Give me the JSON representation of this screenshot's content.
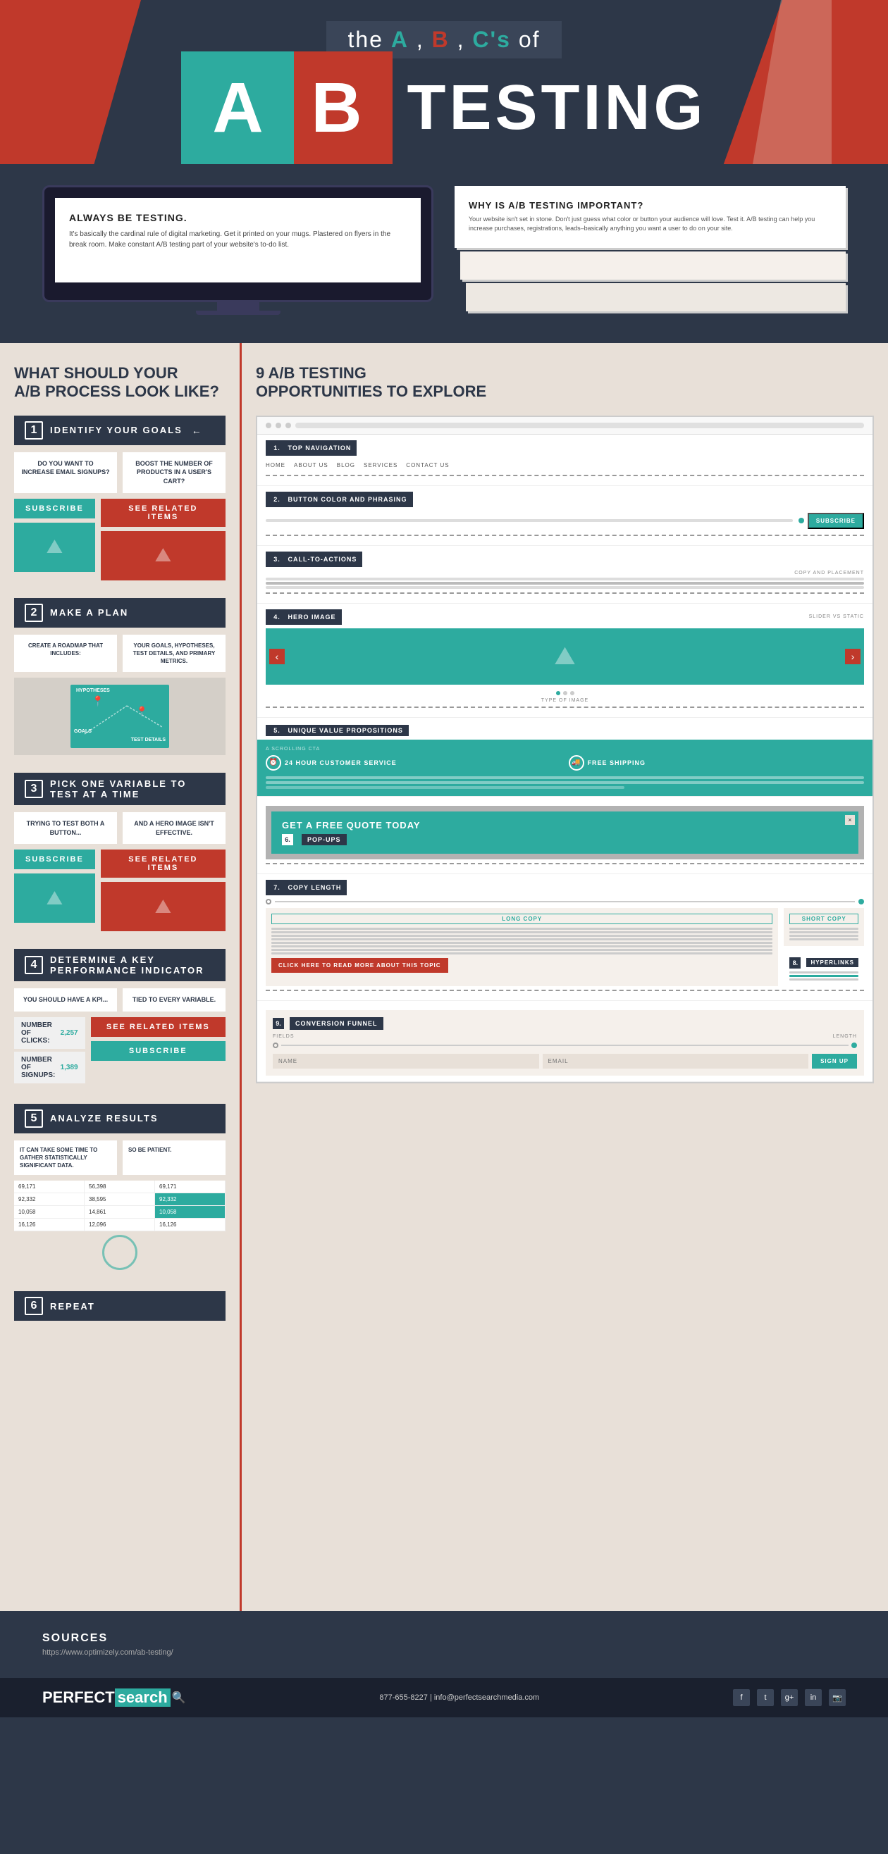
{
  "header": {
    "title_line": "the A, B, C's of",
    "letters": {
      "a": "A",
      "b": "B",
      "cs": "C's"
    },
    "testing_word": "TESTING",
    "big_a": "A",
    "big_b": "B"
  },
  "laptop_card": {
    "title": "ALWAYS BE TESTING.",
    "body": "It's basically the cardinal rule of digital marketing. Get it printed on your mugs. Plastered on flyers in the break room. Make constant A/B testing part of your website's to-do list."
  },
  "paper_card": {
    "title": "WHY IS A/B TESTING IMPORTANT?",
    "body": "Your website isn't set in stone. Don't just guess what color or button your audience will love. Test it. A/B testing can help you increase purchases, registrations, leads–basically anything you want a user to do on your site."
  },
  "left_section": {
    "title_line1": "WHAT SHOULD YOUR",
    "title_line2": "A/B PROCESS LOOK LIKE?",
    "steps": [
      {
        "number": "1",
        "label": "IDENTIFY YOUR GOALS",
        "col1": "DO YOU WANT TO INCREASE EMAIL SIGNUPS?",
        "col2": "BOOST THE NUMBER OF PRODUCTS IN A USER'S CART?",
        "btn1": "SUBSCRIBE",
        "btn2": "SEE RELATED ITEMS"
      },
      {
        "number": "2",
        "label": "MAKE A PLAN",
        "col1": "CREATE A ROADMAP THAT INCLUDES:",
        "col2": "YOUR GOALS, HYPOTHESES, TEST DETAILS, AND PRIMARY METRICS."
      },
      {
        "number": "3",
        "label": "PICK ONE VARIABLE TO TEST AT A TIME",
        "col1": "TRYING TO TEST BOTH A BUTTON...",
        "col2": "AND A HERO IMAGE ISN'T EFFECTIVE.",
        "btn1": "SUBSCRIBE",
        "btn2": "SEE RELATED ITEMS"
      },
      {
        "number": "4",
        "label": "DETERMINE A KEY PERFORMANCE INDICATOR",
        "col1": "YOU SHOULD HAVE A KPI...",
        "col2": "TIED TO EVERY VARIABLE.",
        "kpi1_label": "NUMBER OF CLICKS:",
        "kpi1_value": "2,257",
        "kpi2_label": "NUMBER OF SIGNUPS:",
        "kpi2_value": "1,389",
        "btn_red": "SEE RELATED ITEMS",
        "btn_teal": "SUBSCRIBE"
      },
      {
        "number": "5",
        "label": "ANALYZE RESULTS",
        "col1": "IT CAN TAKE SOME TIME TO GATHER STATISTICALLY SIGNIFICANT DATA.",
        "col2": "SO BE PATIENT.",
        "table_rows": [
          [
            "69,171",
            "56,398",
            "69,171"
          ],
          [
            "92,332",
            "38,595",
            "92,332"
          ],
          [
            "10,058",
            "14,861",
            "10,058"
          ],
          [
            "16,126",
            "12,096",
            "16,126"
          ]
        ]
      },
      {
        "number": "6",
        "label": "REPEAT"
      }
    ]
  },
  "right_section": {
    "title_line1": "9 A/B TESTING",
    "title_line2": "OPPORTUNITIES TO EXPLORE",
    "items": [
      {
        "number": "1",
        "label": "TOP NAVIGATION"
      },
      {
        "number": "2",
        "label": "BUTTON COLOR AND PHRASING"
      },
      {
        "number": "3",
        "label": "CALL-TO-ACTIONS",
        "sublabel": "COPY AND PLACEMENT"
      },
      {
        "number": "4",
        "label": "HERO IMAGE",
        "sublabel": "SLIDER VS STATIC",
        "type_label": "TYPE OF IMAGE"
      },
      {
        "number": "5",
        "label": "UNIQUE VALUE PROPOSITIONS",
        "sublabel": "A SCROLLING CTA"
      },
      {
        "number": "6",
        "label": "POP-UPS",
        "popup_title": "GET A FREE QUOTE TODAY"
      },
      {
        "number": "7",
        "label": "COPY LENGTH",
        "sub1": "LONG COPY",
        "sub2": "SHORT COPY"
      },
      {
        "number": "8",
        "label": "HYPERLINKS"
      },
      {
        "number": "9",
        "label": "CONVERSION FUNNEL",
        "sub1": "FIELDS",
        "sub2": "LENGTH"
      }
    ],
    "nav_links": [
      "HOME",
      "ABOUT US",
      "BLOG",
      "SERVICES",
      "CONTACT US"
    ],
    "subscribe_btn": "SUBSCRIBE",
    "uvp_features": [
      {
        "icon": "⏰",
        "text": "24 HOUR CUSTOMER SERVICE"
      },
      {
        "icon": "🚚",
        "text": "FREE SHIPPING"
      }
    ],
    "funnel_inputs": [
      "NAME",
      "EMAIL"
    ],
    "funnel_btn": "SIGN UP",
    "click_here_btn": "CLICK HERE TO READ MORE ABOUT THIS TOPIC"
  },
  "footer": {
    "sources_title": "SOURCES",
    "sources_url": "https://www.optimizely.com/ab-testing/",
    "logo_perfect": "PERFECT",
    "logo_search": "search",
    "phone": "877-655-8227",
    "email": "info@perfectsearchmedia.com",
    "social_icons": [
      "f",
      "t",
      "g+",
      "in",
      "📷"
    ]
  }
}
